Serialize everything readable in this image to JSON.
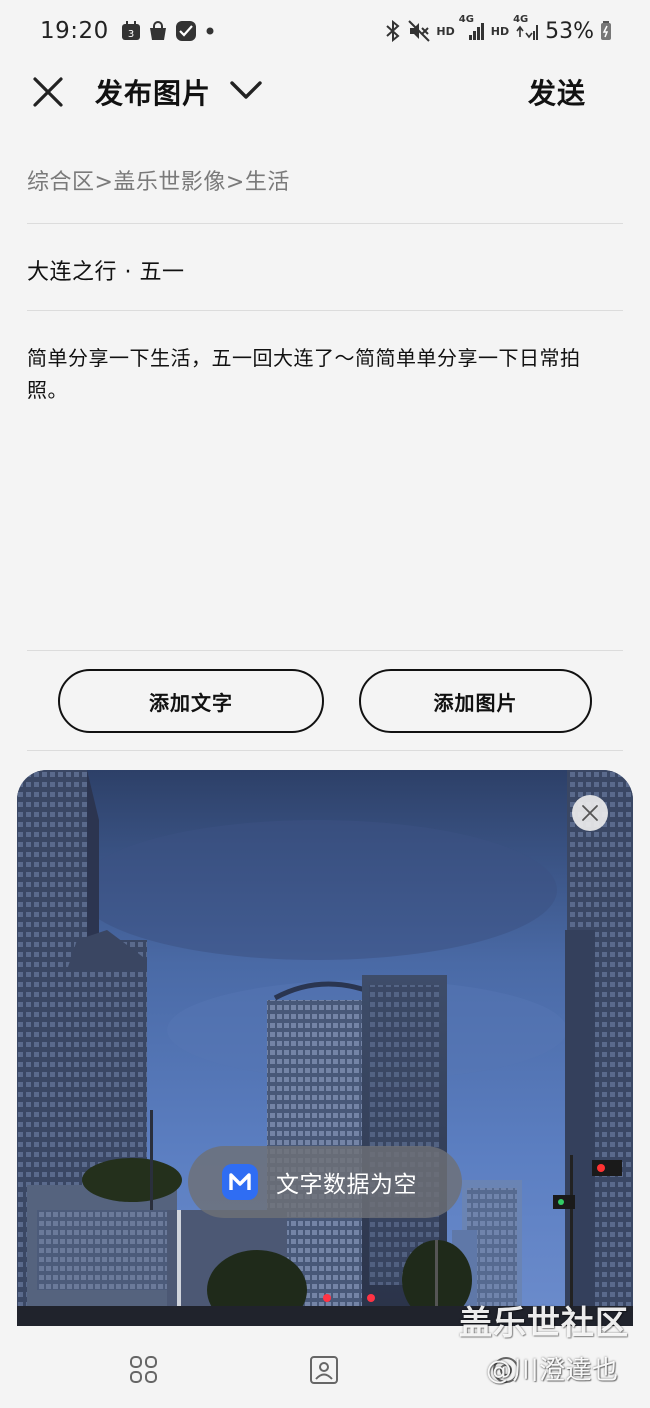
{
  "status_bar": {
    "time": "19:20",
    "calendar_day": "3",
    "hd1": "HD",
    "net1": "4G",
    "hd2": "HD",
    "net2": "4G",
    "battery": "53%",
    "icons": [
      "calendar-icon",
      "shopping-bag-icon",
      "checklist-icon",
      "dot-icon",
      "bluetooth-icon",
      "mute-icon",
      "signal-icon",
      "battery-icon"
    ]
  },
  "header": {
    "title": "发布图片",
    "send_label": "发送"
  },
  "compose": {
    "category": "综合区>盖乐世影像>生活",
    "title": "大连之行 · 五一",
    "body": "简单分享一下生活，五一回大连了～简简单单分享一下日常拍照。"
  },
  "actions": {
    "add_text": "添加文字",
    "add_image": "添加图片"
  },
  "toast": {
    "text": "文字数据为空",
    "logo_letter": "M"
  },
  "watermark": {
    "main": "盖乐世社区",
    "sub": "@川澄達也"
  },
  "colors": {
    "background": "#f4f4f4",
    "toast_logo": "#2f6df3",
    "text": "#111111",
    "muted": "#7a7a7a"
  }
}
